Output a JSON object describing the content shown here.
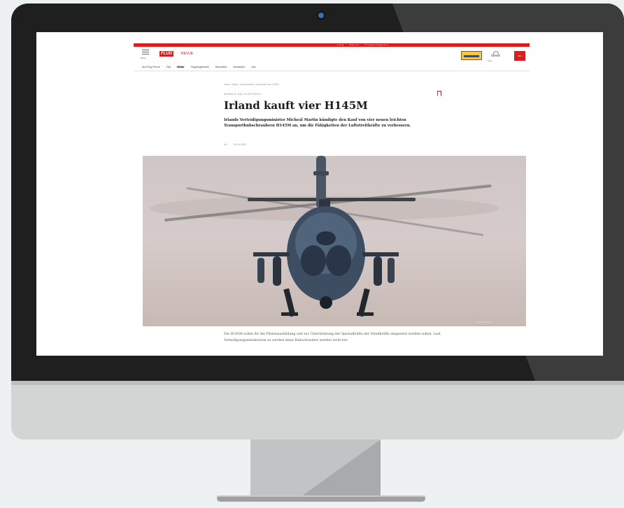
{
  "top_links": [
    "Flug",
    "Revue",
    "Fliegermagazin"
  ],
  "header": {
    "menu_label": "Menü",
    "logo_text": "FLUG",
    "logo_sub": "REVUE",
    "shop_label": "Shop",
    "abo_label": "Abo"
  },
  "nav": {
    "items": [
      "Aus Flug Revue",
      "Zivil",
      "Militär",
      "Flugzeugtechnik",
      "Raumfahrt",
      "Newsletter",
      "Abo"
    ]
  },
  "article": {
    "breadcrumb": "Home  ›  Militär  ›  Hubschrauber  ›  Irland kauft vier H145M",
    "kicker": "AIRBUS HELICOPTERS",
    "title": "Irland kauft vier H145M",
    "lead": "Irlands Verteidigungsminister Micheál Martin kündigte den Kauf von vier neuen leichten Transporthubschraubern H145M an, um die Fähigkeiten der Luftstreitkräfte zu verbessern.",
    "author": "KA",
    "date": "09.04.2025",
    "image_credit": "Airbus Helicopters",
    "body": "Die H145M sollen für die Pilotenausbildung und zur Unterstützung der Spezialkräfte der Streitkräfte eingesetzt werden sollen. Laut Verteidigungsministerium zu werden diese Hubschrauber werden nicht nur"
  },
  "colors": {
    "brand_red": "#d81e1e",
    "bezel": "#1f1f1f",
    "chin": "#d3d4d4"
  }
}
